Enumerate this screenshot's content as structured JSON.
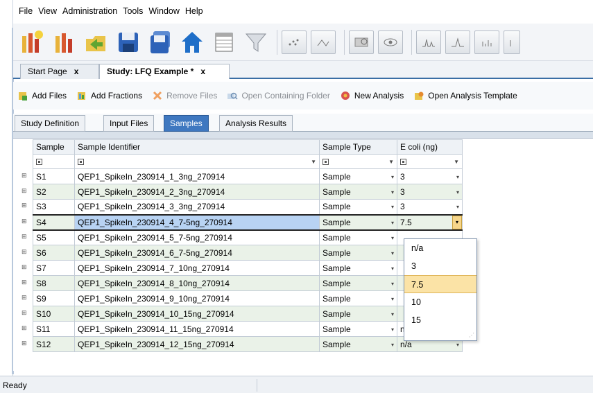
{
  "menu": [
    "File",
    "View",
    "Administration",
    "Tools",
    "Window",
    "Help"
  ],
  "doc_tabs": [
    {
      "label": "Start Page",
      "close": "x"
    },
    {
      "label": "Study: LFQ Example *",
      "close": "x"
    }
  ],
  "actions": {
    "add_files": "Add Files",
    "add_fractions": "Add Fractions",
    "remove_files": "Remove Files",
    "open_containing_folder": "Open Containing Folder",
    "new_analysis": "New Analysis",
    "open_analysis_template": "Open Analysis Template"
  },
  "sub_tabs": [
    "Study Definition",
    "Input Files",
    "Samples",
    "Analysis Results"
  ],
  "grid": {
    "columns": [
      "Sample",
      "Sample Identifier",
      "Sample Type",
      "E coli (ng)"
    ],
    "rows": [
      {
        "sample": "S1",
        "identifier": "QEP1_SpikeIn_230914_1_3ng_270914",
        "type": "Sample",
        "ecoli": "3"
      },
      {
        "sample": "S2",
        "identifier": "QEP1_SpikeIn_230914_2_3ng_270914",
        "type": "Sample",
        "ecoli": "3"
      },
      {
        "sample": "S3",
        "identifier": "QEP1_SpikeIn_230914_3_3ng_270914",
        "type": "Sample",
        "ecoli": "3"
      },
      {
        "sample": "S4",
        "identifier": "QEP1_SpikeIn_230914_4_7-5ng_270914",
        "type": "Sample",
        "ecoli": "7.5"
      },
      {
        "sample": "S5",
        "identifier": "QEP1_SpikeIn_230914_5_7-5ng_270914",
        "type": "Sample",
        "ecoli": ""
      },
      {
        "sample": "S6",
        "identifier": "QEP1_SpikeIn_230914_6_7-5ng_270914",
        "type": "Sample",
        "ecoli": ""
      },
      {
        "sample": "S7",
        "identifier": "QEP1_SpikeIn_230914_7_10ng_270914",
        "type": "Sample",
        "ecoli": ""
      },
      {
        "sample": "S8",
        "identifier": "QEP1_SpikeIn_230914_8_10ng_270914",
        "type": "Sample",
        "ecoli": ""
      },
      {
        "sample": "S9",
        "identifier": "QEP1_SpikeIn_230914_9_10ng_270914",
        "type": "Sample",
        "ecoli": ""
      },
      {
        "sample": "S10",
        "identifier": "QEP1_SpikeIn_230914_10_15ng_270914",
        "type": "Sample",
        "ecoli": ""
      },
      {
        "sample": "S11",
        "identifier": "QEP1_SpikeIn_230914_11_15ng_270914",
        "type": "Sample",
        "ecoli": "n/a"
      },
      {
        "sample": "S12",
        "identifier": "QEP1_SpikeIn_230914_12_15ng_270914",
        "type": "Sample",
        "ecoli": "n/a"
      }
    ]
  },
  "dropdown_options": [
    "n/a",
    "3",
    "7.5",
    "10",
    "15"
  ],
  "status": "Ready",
  "colors": {
    "accent": "#3f78c0",
    "selection": "#b8d3f3",
    "alt_row": "#eaf2e8",
    "highlight": "#fbe3a6"
  }
}
